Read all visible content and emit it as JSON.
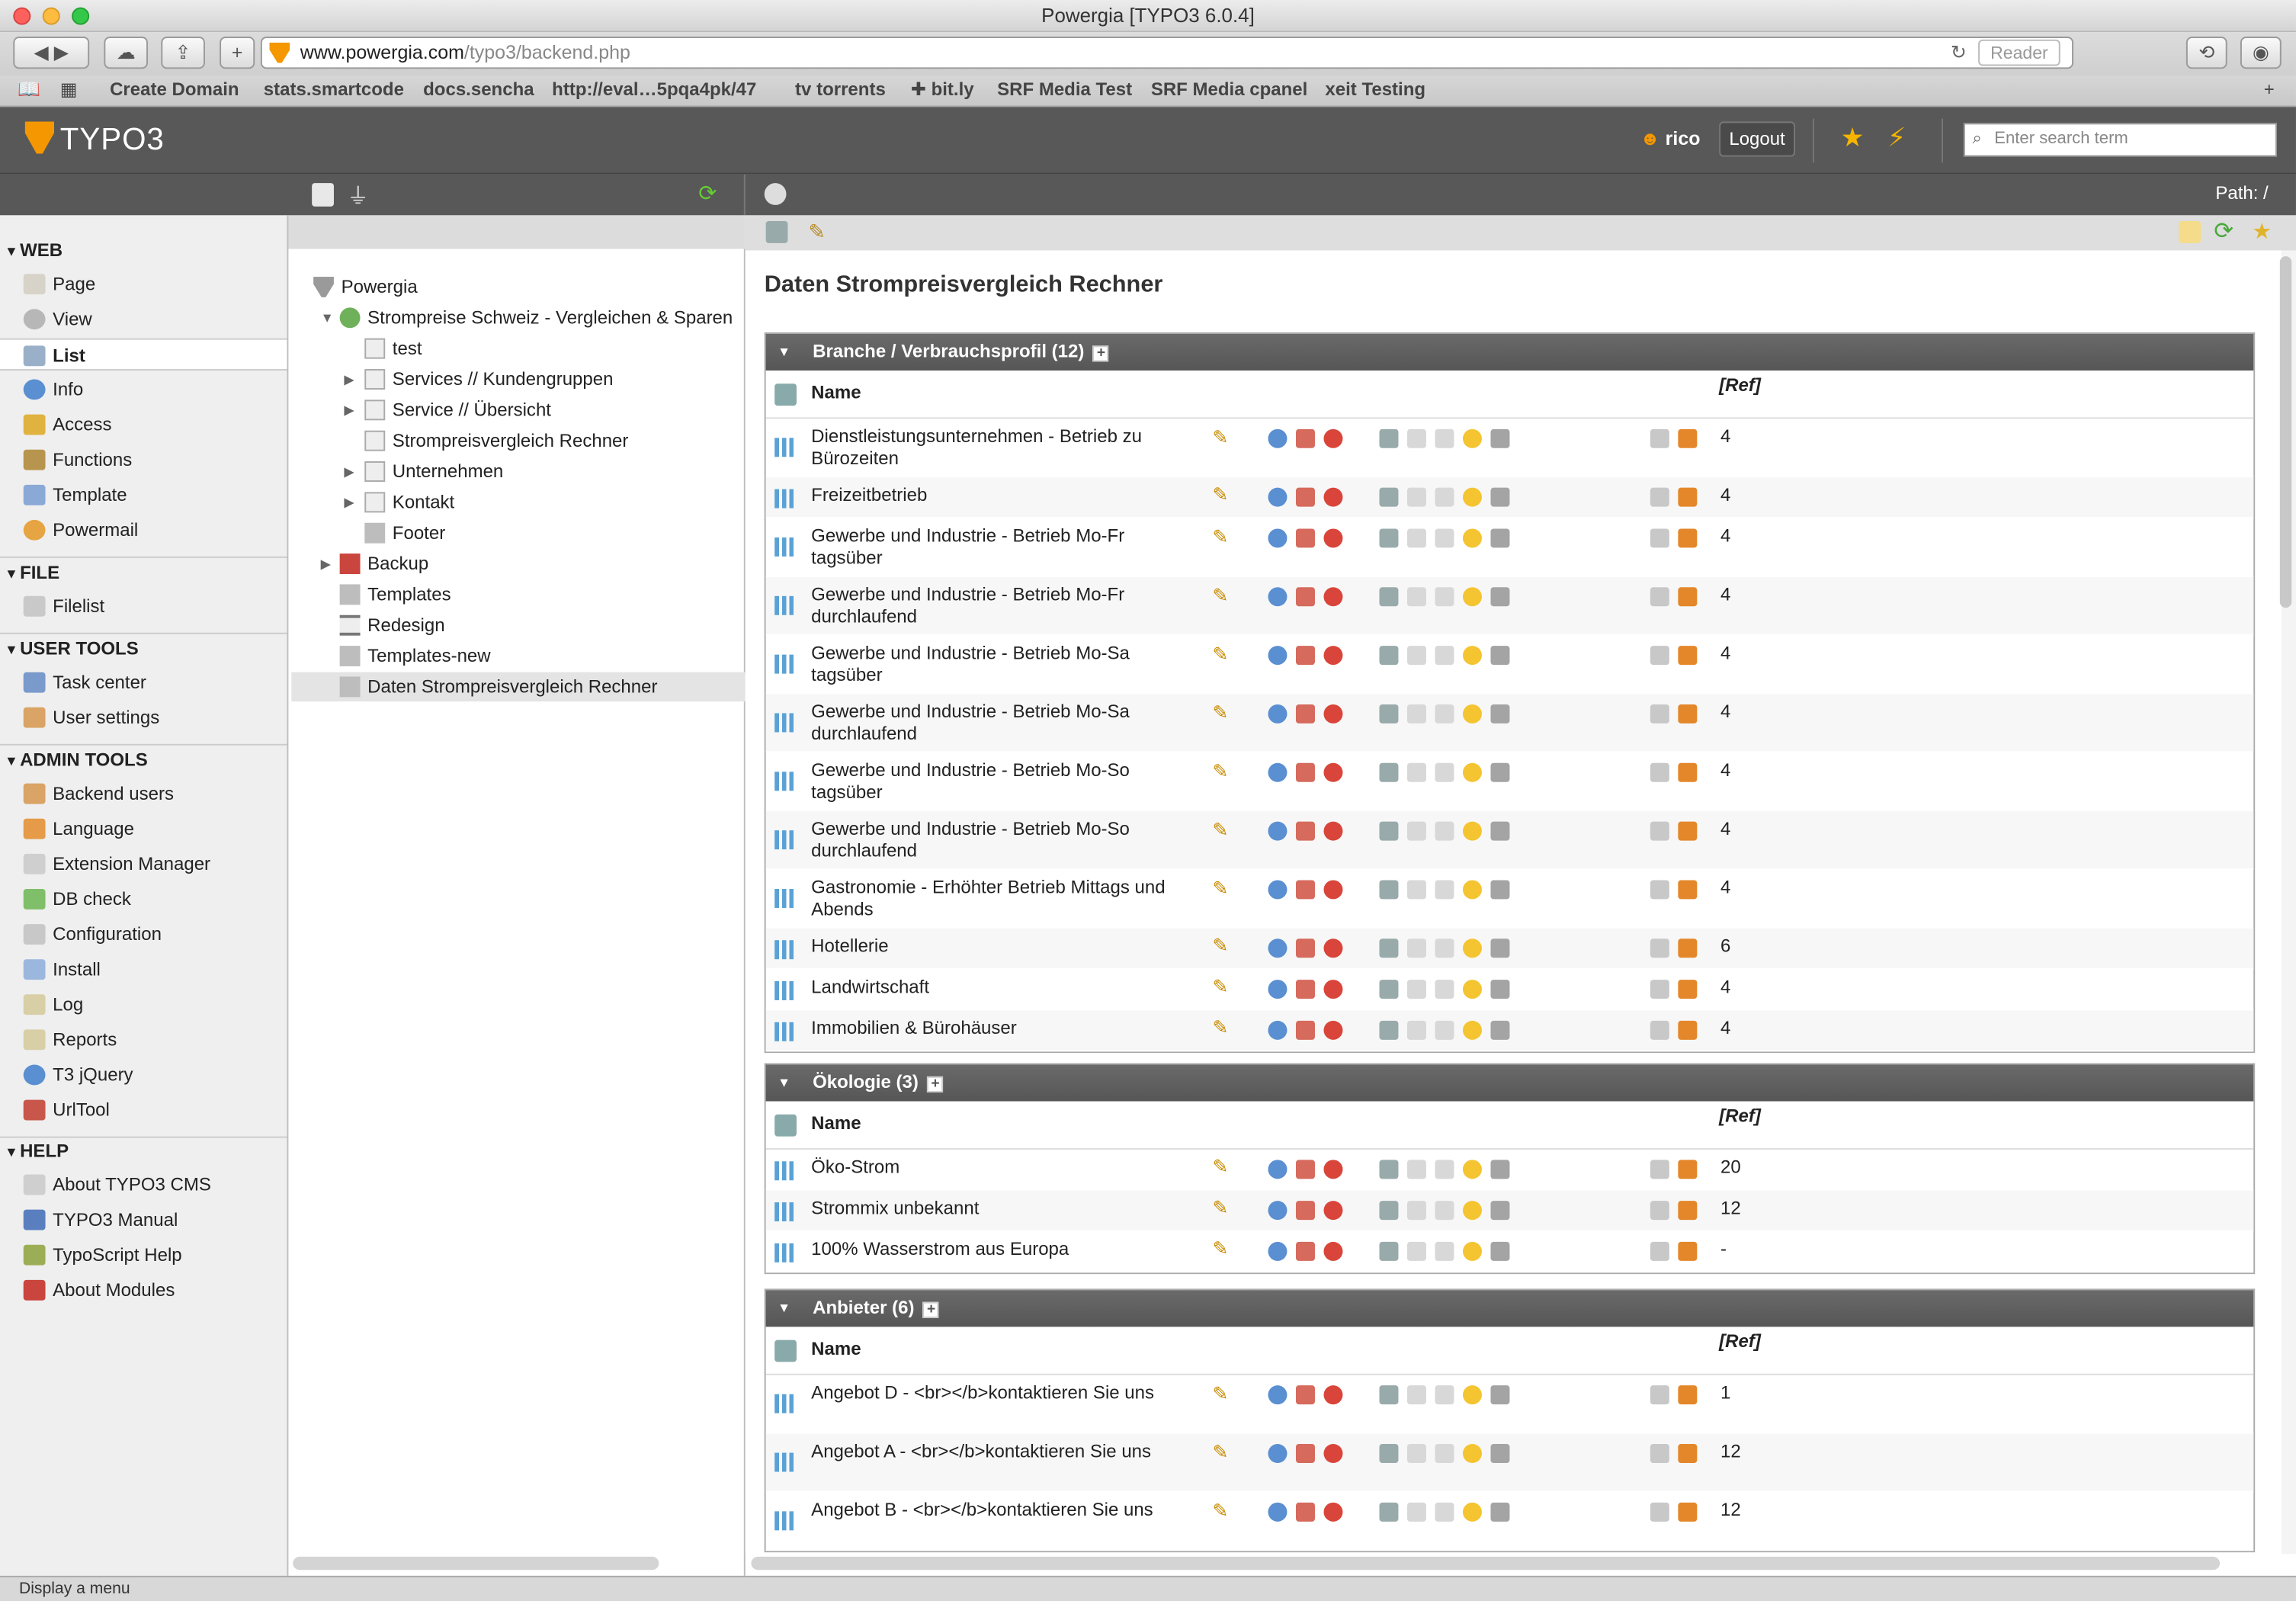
{
  "window": {
    "title": "Powergia [TYPO3 6.0.4]"
  },
  "browser": {
    "url_host": "www.powergia.com",
    "url_path": "/typo3/backend.php",
    "reader_label": "Reader",
    "bookmarks": [
      "Create Domain",
      "stats.smartcode",
      "docs.sencha",
      "http://eval…5pqa4pk/47",
      "tv torrents",
      "✚ bit.ly",
      "SRF Media Test",
      "SRF Media cpanel",
      "xeit Testing"
    ]
  },
  "typo3": {
    "logo_text": "TYPO3",
    "username": "rico",
    "logout_label": "Logout",
    "search_placeholder": "Enter search term",
    "path_label": "Path: /"
  },
  "modules": {
    "web_title": "WEB",
    "web": [
      "Page",
      "View",
      "List",
      "Info",
      "Access",
      "Functions",
      "Template",
      "Powermail"
    ],
    "file_title": "FILE",
    "file": [
      "Filelist"
    ],
    "user_title": "USER TOOLS",
    "user": [
      "Task center",
      "User settings"
    ],
    "admin_title": "ADMIN TOOLS",
    "admin": [
      "Backend users",
      "Language",
      "Extension Manager",
      "DB check",
      "Configuration",
      "Install",
      "Log",
      "Reports",
      "T3 jQuery",
      "UrlTool"
    ],
    "help_title": "HELP",
    "help": [
      "About TYPO3 CMS",
      "TYPO3 Manual",
      "TypoScript Help",
      "About Modules"
    ]
  },
  "tree": [
    "Powergia",
    "Strompreise Schweiz - Vergleichen & Sparen",
    "test",
    "Services // Kundengruppen",
    "Service // Übersicht",
    "Strompreisvergleich Rechner",
    "Unternehmen",
    "Kontakt",
    "Footer",
    "Backup",
    "Templates",
    "Redesign",
    "Templates-new",
    "Daten Strompreisvergleich Rechner"
  ],
  "content": {
    "page_title": "Daten Strompreisvergleich Rechner",
    "col_name": "Name",
    "col_ref": "[Ref]",
    "tables": [
      {
        "header": "Branche / Verbrauchsprofil (12)",
        "rows": [
          {
            "name": "Dienstleistungsunternehmen - Betrieb zu Bürozeiten",
            "ref": "4"
          },
          {
            "name": "Freizeitbetrieb",
            "ref": "4"
          },
          {
            "name": "Gewerbe und Industrie - Betrieb Mo-Fr tagsüber",
            "ref": "4"
          },
          {
            "name": "Gewerbe und Industrie - Betrieb Mo-Fr durchlaufend",
            "ref": "4"
          },
          {
            "name": "Gewerbe und Industrie - Betrieb Mo-Sa tagsüber",
            "ref": "4"
          },
          {
            "name": "Gewerbe und Industrie - Betrieb Mo-Sa durchlaufend",
            "ref": "4"
          },
          {
            "name": "Gewerbe und Industrie - Betrieb Mo-So tagsüber",
            "ref": "4"
          },
          {
            "name": "Gewerbe und Industrie - Betrieb Mo-So durchlaufend",
            "ref": "4"
          },
          {
            "name": "Gastronomie - Erhöhter Betrieb Mittags und Abends",
            "ref": "4"
          },
          {
            "name": "Hotellerie",
            "ref": "6"
          },
          {
            "name": "Landwirtschaft",
            "ref": "4"
          },
          {
            "name": "Immobilien & Bürohäuser",
            "ref": "4"
          }
        ]
      },
      {
        "header": "Ökologie (3)",
        "rows": [
          {
            "name": "Öko-Strom",
            "ref": "20"
          },
          {
            "name": "Strommix unbekannt",
            "ref": "12"
          },
          {
            "name": "100% Wasserstrom aus Europa",
            "ref": "-"
          }
        ]
      },
      {
        "header": "Anbieter (6)",
        "rows": [
          {
            "name": "Angebot D - <br></b>kontaktieren Sie uns",
            "ref": "1"
          },
          {
            "name": "Angebot A - <br></b>kontaktieren Sie uns",
            "ref": "12"
          },
          {
            "name": "Angebot B - <br></b>kontaktieren Sie uns",
            "ref": "12"
          }
        ]
      }
    ]
  },
  "status_text": "Display a menu",
  "colors": {
    "accent": "#f49700",
    "dark_bar": "#585858",
    "table_head": "#5e5e5e"
  }
}
